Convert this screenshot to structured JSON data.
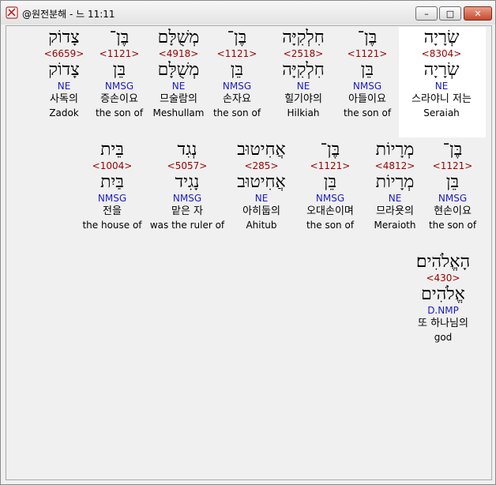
{
  "window": {
    "title": "@원전분해 - 느 11:11",
    "min_label": "–",
    "max_label": "□",
    "close_label": "✕"
  },
  "rows": [
    [
      {
        "heb": "שְׂרָיָה",
        "strong": "<8304>",
        "heb2": "שְׂרָיָה",
        "morph": "NE",
        "kor": "스라야니 저는",
        "eng": "Seraiah"
      },
      {
        "heb": "בֶּן־",
        "strong": "<1121>",
        "heb2": "בֵּן",
        "morph": "NMSG",
        "kor": "아들이요",
        "eng": "the son of"
      },
      {
        "heb": "חִלְקִיָּה",
        "strong": "<2518>",
        "heb2": "חִלְקִיָּה",
        "morph": "NE",
        "kor": "힐기야의",
        "eng": "Hilkiah"
      },
      {
        "heb": "בֶּן־",
        "strong": "<1121>",
        "heb2": "בֵּן",
        "morph": "NMSG",
        "kor": "손자요",
        "eng": "the son of"
      },
      {
        "heb": "מְשֻׁלָּם",
        "strong": "<4918>",
        "heb2": "מְשֻׁלָּם",
        "morph": "NE",
        "kor": "므술람의",
        "eng": "Meshullam"
      },
      {
        "heb": "בֶּן־",
        "strong": "<1121>",
        "heb2": "בֵּן",
        "morph": "NMSG",
        "kor": "증손이요",
        "eng": "the son of"
      },
      {
        "heb": "צָדוֹק",
        "strong": "<6659>",
        "heb2": "צָדוֹק",
        "morph": "NE",
        "kor": "사독의",
        "eng": "Zadok"
      }
    ],
    [
      {
        "heb": "בֶּן־",
        "strong": "<1121>",
        "heb2": "בֵּן",
        "morph": "NMSG",
        "kor": "현손이요",
        "eng": "the son of"
      },
      {
        "heb": "מְרָיוֹת",
        "strong": "<4812>",
        "heb2": "מְרָיוֹת",
        "morph": "NE",
        "kor": "므라욧의",
        "eng": "Meraioth"
      },
      {
        "heb": "בֶּן־",
        "strong": "<1121>",
        "heb2": "בֵּן",
        "morph": "NMSG",
        "kor": "오대손이며",
        "eng": "the son of"
      },
      {
        "heb": "אֲחִיטוּב",
        "strong": "<285>",
        "heb2": "אֲחִיטוּב",
        "morph": "NE",
        "kor": "아히둡의",
        "eng": "Ahitub"
      },
      {
        "heb": "נְגִד",
        "strong": "<5057>",
        "heb2": "נָגִיד",
        "morph": "NMSG",
        "kor": "맡은 자",
        "eng": "was the ruler of"
      },
      {
        "heb": "בֵּית",
        "strong": "<1004>",
        "heb2": "בַּיִת",
        "morph": "NMSG",
        "kor": "전을",
        "eng": "the house of"
      }
    ],
    [
      {
        "heb": "הָאֱלֹהִים׃",
        "strong": "<430>",
        "heb2": "אֱלֹהִים",
        "morph": "D.NMP",
        "kor": "또 하나님의",
        "eng": "god"
      }
    ]
  ]
}
